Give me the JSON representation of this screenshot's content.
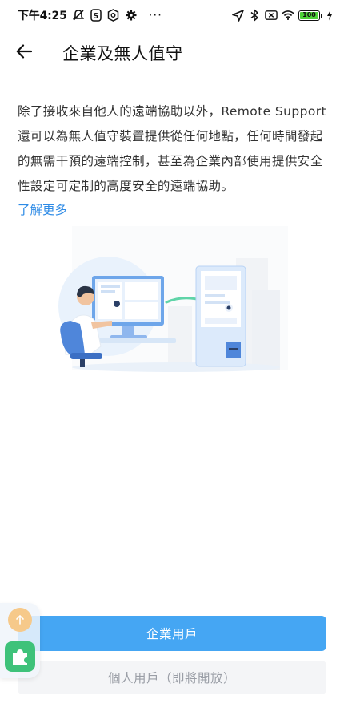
{
  "status_bar": {
    "time": "下午4:25",
    "left_icons": [
      "mute-bell-icon",
      "s-app-icon",
      "shield-app-icon",
      "gear-icon",
      "more-dots-icon"
    ],
    "right_icons": [
      "location-arrow-icon",
      "bluetooth-icon",
      "no-sim-icon",
      "wifi-icon",
      "battery-icon",
      "charging-icon"
    ],
    "battery_level": "100",
    "more_text": "···"
  },
  "header": {
    "back_icon": "arrow-left-icon",
    "title": "企業及無人值守"
  },
  "main": {
    "description": "除了接收來自他人的遠端協助以外，Remote Support還可以為無人值守裝置提供從任何地點，任何時間發起的無需干預的遠端控制，甚至為企業內部使用提供安全性設定可定制的高度安全的遠端協助。",
    "learn_more": "了解更多",
    "illustration": "person-at-computer-remote-to-kiosk-illustration"
  },
  "actions": {
    "enterprise_label": "企業用戶",
    "personal_label": "個人用戶（即將開放）"
  },
  "colors": {
    "primary": "#45a6f3",
    "link": "#2e8be6",
    "disabled_bg": "#f4f5f7",
    "disabled_text": "#9a9ea6"
  }
}
